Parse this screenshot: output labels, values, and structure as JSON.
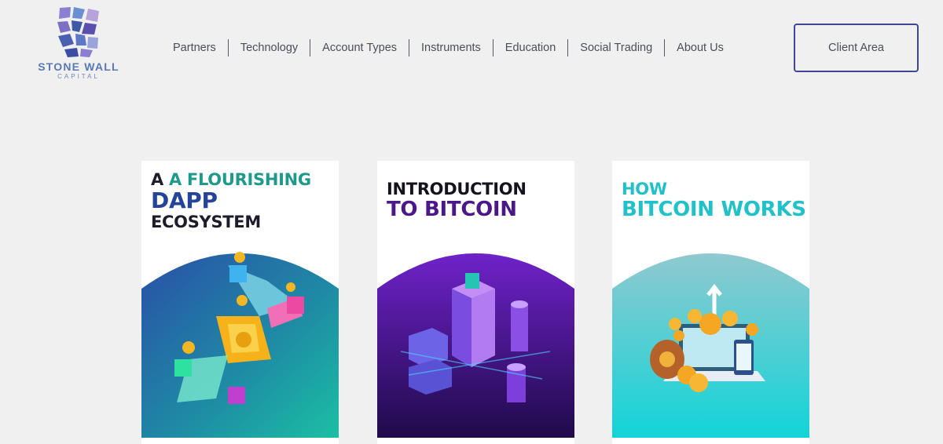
{
  "logo": {
    "name": "STONE WALL",
    "tagline": "CAPITAL"
  },
  "nav": {
    "items": [
      "Partners",
      "Technology",
      "Account Types",
      "Instruments",
      "Education",
      "Social Trading",
      "About Us"
    ]
  },
  "client_area": {
    "label": "Client Area"
  },
  "cards": [
    {
      "title_lines": [
        "A FLOURISHING",
        "DAPP",
        "ECOSYSTEM"
      ]
    },
    {
      "title_lines": [
        "INTRODUCTION",
        "TO BITCOIN"
      ]
    },
    {
      "title_lines": [
        "HOW",
        "BITCOIN WORKS"
      ]
    }
  ],
  "colors": {
    "background": "#f0f0f1",
    "button_border": "#3e4791",
    "logo_text": "#5a78b3",
    "card1_accent": "#1f9a8a",
    "card2_accent": "#4b1889",
    "card3_accent": "#20c1c9"
  }
}
